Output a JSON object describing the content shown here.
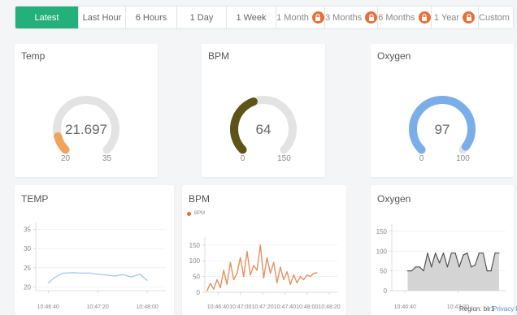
{
  "time_range": {
    "buttons": [
      {
        "label": "Latest",
        "active": true,
        "locked": false
      },
      {
        "label": "Last Hour",
        "active": false,
        "locked": false
      },
      {
        "label": "6 Hours",
        "active": false,
        "locked": false
      },
      {
        "label": "1 Day",
        "active": false,
        "locked": false
      },
      {
        "label": "1 Week",
        "active": false,
        "locked": false
      },
      {
        "label": "1 Month",
        "active": false,
        "locked": true
      },
      {
        "label": "3 Months",
        "active": false,
        "locked": true
      },
      {
        "label": "6 Months",
        "active": false,
        "locked": true
      },
      {
        "label": "1 Year",
        "active": false,
        "locked": true
      },
      {
        "label": "Custom",
        "active": false,
        "locked": true
      }
    ],
    "lock_icon": "lock-icon",
    "colors": {
      "active": "#23b07d",
      "lock": "#e76f3a"
    }
  },
  "gauges": [
    {
      "title": "Temp",
      "value": "21.697",
      "min": "20",
      "max": "35",
      "fraction": 0.113,
      "color": "#f0a35a"
    },
    {
      "title": "BPM",
      "value": "64",
      "min": "0",
      "max": "150",
      "fraction": 0.427,
      "color": "#5d5518"
    },
    {
      "title": "Oxygen",
      "value": "97",
      "min": "0",
      "max": "100",
      "fraction": 0.97,
      "color": "#7aaee8"
    }
  ],
  "charts": {
    "temp": {
      "title": "TEMP"
    },
    "bpm": {
      "title": "BPM",
      "legend": "BPM"
    },
    "oxygen": {
      "title": "Oxygen"
    }
  },
  "chart_data": [
    {
      "type": "line",
      "title": "TEMP",
      "xticks": [
        "10:46:40",
        "10:47:20",
        "10:48:00"
      ],
      "yticks": [
        "20",
        "25",
        "30",
        "35"
      ],
      "ylim": [
        19,
        36
      ],
      "x_span": [
        "10:46:30",
        "10:48:15"
      ],
      "series": [
        {
          "color": "#a8cdf0",
          "x": [
            "10:46:40",
            "10:46:45",
            "10:46:52",
            "10:47:00",
            "10:47:07",
            "10:47:14",
            "10:47:20",
            "10:47:27",
            "10:47:34",
            "10:47:40",
            "10:47:47",
            "10:47:54",
            "10:48:00"
          ],
          "values": [
            21.0,
            22.4,
            23.6,
            23.7,
            23.6,
            23.6,
            23.3,
            23.1,
            22.8,
            23.2,
            22.6,
            23.3,
            21.7
          ]
        }
      ]
    },
    {
      "type": "line",
      "title": "BPM",
      "xticks": [
        "10:46:40",
        "10:47:00",
        "10:47:20",
        "10:47:40",
        "10:48:00",
        "10:48:20"
      ],
      "yticks": [
        "0",
        "50",
        "100",
        "150"
      ],
      "ylim": [
        0,
        165
      ],
      "x_span": [
        "10:46:28",
        "10:48:28"
      ],
      "series": [
        {
          "name": "BPM",
          "color": "#e59060",
          "x": [
            "10:46:30",
            "10:46:33",
            "10:46:36",
            "10:46:39",
            "10:46:42",
            "10:46:45",
            "10:46:48",
            "10:46:51",
            "10:46:54",
            "10:46:57",
            "10:47:00",
            "10:47:03",
            "10:47:06",
            "10:47:09",
            "10:47:12",
            "10:47:15",
            "10:47:18",
            "10:47:21",
            "10:47:24",
            "10:47:27",
            "10:47:30",
            "10:47:33",
            "10:47:36",
            "10:47:39",
            "10:47:42",
            "10:47:45",
            "10:47:48",
            "10:47:51",
            "10:47:54",
            "10:47:57",
            "10:48:00",
            "10:48:03",
            "10:48:06",
            "10:48:09"
          ],
          "values": [
            5,
            28,
            10,
            40,
            15,
            70,
            25,
            95,
            40,
            60,
            110,
            50,
            130,
            55,
            85,
            70,
            150,
            45,
            110,
            60,
            95,
            30,
            80,
            40,
            65,
            25,
            55,
            30,
            50,
            40,
            55,
            50,
            60,
            62
          ]
        }
      ]
    },
    {
      "type": "area",
      "title": "Oxygen",
      "xticks": [
        "10:46:40",
        "10:47:20"
      ],
      "yticks": [
        "0",
        "50",
        "100",
        "150"
      ],
      "ylim": [
        0,
        160
      ],
      "x_span": [
        "10:46:30",
        "10:47:56"
      ],
      "series": [
        {
          "color": "#555555",
          "fill": "#d4d4d4",
          "x": [
            "10:46:42",
            "10:46:45",
            "10:46:48",
            "10:46:51",
            "10:46:54",
            "10:46:57",
            "10:47:00",
            "10:47:03",
            "10:47:06",
            "10:47:09",
            "10:47:12",
            "10:47:15",
            "10:47:18",
            "10:47:21",
            "10:47:24",
            "10:47:27",
            "10:47:30",
            "10:47:33",
            "10:47:36",
            "10:47:39",
            "10:47:42",
            "10:47:45",
            "10:47:48",
            "10:47:51"
          ],
          "values": [
            50,
            50,
            60,
            60,
            50,
            95,
            60,
            95,
            70,
            95,
            60,
            95,
            95,
            60,
            90,
            95,
            60,
            65,
            95,
            95,
            50,
            50,
            95,
            95
          ]
        }
      ]
    }
  ],
  "footer": {
    "region": "Region: blr1",
    "privacy": "Privacy Po"
  }
}
